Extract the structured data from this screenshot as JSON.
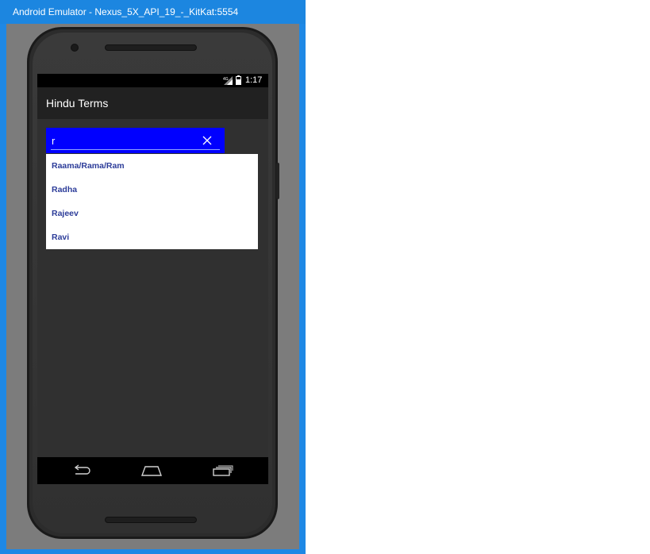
{
  "window": {
    "title": "Android Emulator - Nexus_5X_API_19_-_KitKat:5554"
  },
  "statusbar": {
    "time": "1:17",
    "signal_icon": "signal-4g-icon",
    "battery_icon": "battery-icon"
  },
  "app": {
    "title": "Hindu Terms"
  },
  "search": {
    "value": "r",
    "clear_icon": "close-icon",
    "background": "#0000ff"
  },
  "suggestions": [
    "Raama/Rama/Ram",
    "Radha",
    "Rajeev",
    "Ravi"
  ],
  "navbar": {
    "back_icon": "back-icon",
    "home_icon": "home-icon",
    "recents_icon": "recents-icon"
  }
}
